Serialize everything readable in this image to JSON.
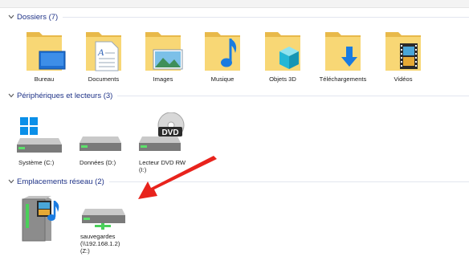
{
  "sections": [
    {
      "title": "Dossiers (7)",
      "items": [
        {
          "label": "Bureau",
          "icon": "desktop-folder-icon"
        },
        {
          "label": "Documents",
          "icon": "documents-folder-icon"
        },
        {
          "label": "Images",
          "icon": "pictures-folder-icon"
        },
        {
          "label": "Musique",
          "icon": "music-folder-icon"
        },
        {
          "label": "Objets 3D",
          "icon": "3d-objects-folder-icon"
        },
        {
          "label": "Téléchargements",
          "icon": "downloads-folder-icon"
        },
        {
          "label": "Vidéos",
          "icon": "videos-folder-icon"
        }
      ]
    },
    {
      "title": "Périphériques et lecteurs (3)",
      "items": [
        {
          "label": "Système (C:)",
          "icon": "system-drive-icon"
        },
        {
          "label": "Données (D:)",
          "icon": "drive-icon"
        },
        {
          "label_lines": [
            "Lecteur DVD RW",
            "(I:)"
          ],
          "icon": "dvd-drive-icon",
          "badge": "DVD"
        }
      ]
    },
    {
      "title": "Emplacements réseau (2)",
      "items": [
        {
          "label": "",
          "icon": "media-server-icon"
        },
        {
          "label_lines": [
            "sauvegardes",
            "(\\\\192.168.1.2)",
            "(Z:)"
          ],
          "icon": "network-drive-icon"
        }
      ]
    }
  ],
  "colors": {
    "section_title": "#1e3287",
    "folder": "#f8d775",
    "folder_dark": "#e8b94a",
    "arrow": "#e8231c"
  }
}
